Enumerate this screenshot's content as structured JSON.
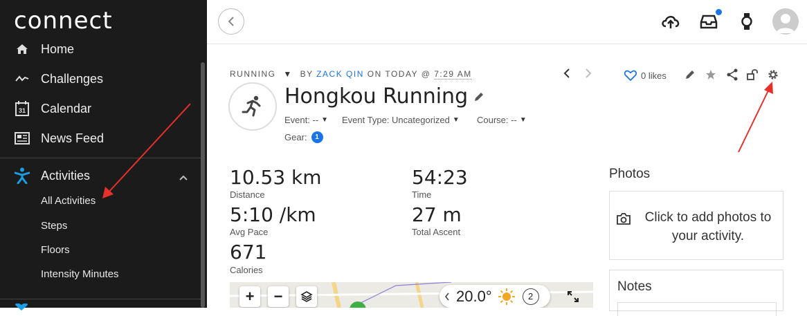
{
  "app": {
    "logo": "connect"
  },
  "sidebar": {
    "items": [
      {
        "label": "Home",
        "icon": "home-icon"
      },
      {
        "label": "Challenges",
        "icon": "challenges-icon"
      },
      {
        "label": "Calendar",
        "icon": "calendar-icon",
        "icon_text": "31"
      },
      {
        "label": "News Feed",
        "icon": "news-feed-icon"
      },
      {
        "label": "Activities",
        "icon": "activities-icon"
      }
    ],
    "sub_items": [
      "All Activities",
      "Steps",
      "Floors",
      "Intensity Minutes"
    ],
    "accent": "#1a73e8"
  },
  "activity": {
    "type": "RUNNING",
    "by_label": "BY",
    "author": "ZACK QIN",
    "on_label": "ON TODAY @",
    "time": "7:29 AM",
    "title": "Hongkou Running",
    "likes": "0 likes",
    "event_label": "Event:",
    "event_value": "--",
    "event_type_label": "Event Type:",
    "event_type_value": "Uncategorized",
    "course_label": "Course:",
    "course_value": "--",
    "gear_label": "Gear:",
    "gear_count": "1"
  },
  "stats": [
    {
      "value": "10.53 km",
      "label": "Distance"
    },
    {
      "value": "54:23",
      "label": "Time"
    },
    {
      "value": "5:10 /km",
      "label": "Avg Pace"
    },
    {
      "value": "27 m",
      "label": "Total Ascent"
    },
    {
      "value": "671",
      "label": "Calories"
    }
  ],
  "map": {
    "temperature": "20.0°",
    "wind": "2"
  },
  "photos": {
    "title": "Photos",
    "prompt": "Click to add photos to your activity."
  },
  "notes": {
    "title": "Notes"
  },
  "colors": {
    "annotation_arrow": "#e8302a",
    "link": "#1a73e8"
  }
}
